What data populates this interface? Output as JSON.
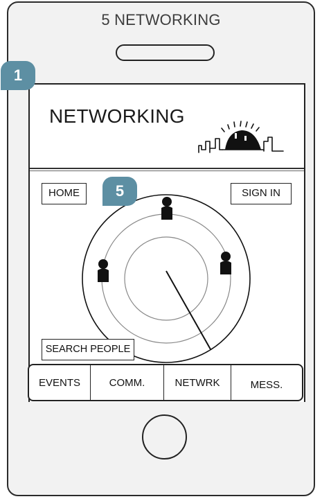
{
  "header": {
    "title": "5 NETWORKING"
  },
  "app": {
    "title": "NETWORKING",
    "logo_icon": "city-sunrise-logo-icon"
  },
  "buttons": {
    "home": "HOME",
    "sign_in": "SIGN IN",
    "search_people": "SEARCH PEOPLE"
  },
  "tabs": [
    {
      "label": "EVENTS"
    },
    {
      "label": "COMM."
    },
    {
      "label": "NETWRK"
    },
    {
      "label": "MESS."
    }
  ],
  "annotations": {
    "badge_1": "1",
    "badge_5": "5"
  },
  "radar": {
    "icon": "radar-icon",
    "person_icon": "person-icon"
  },
  "colors": {
    "badge": "#5d8fa3",
    "outline": "#222222",
    "phone_body": "#f2f2f2"
  }
}
